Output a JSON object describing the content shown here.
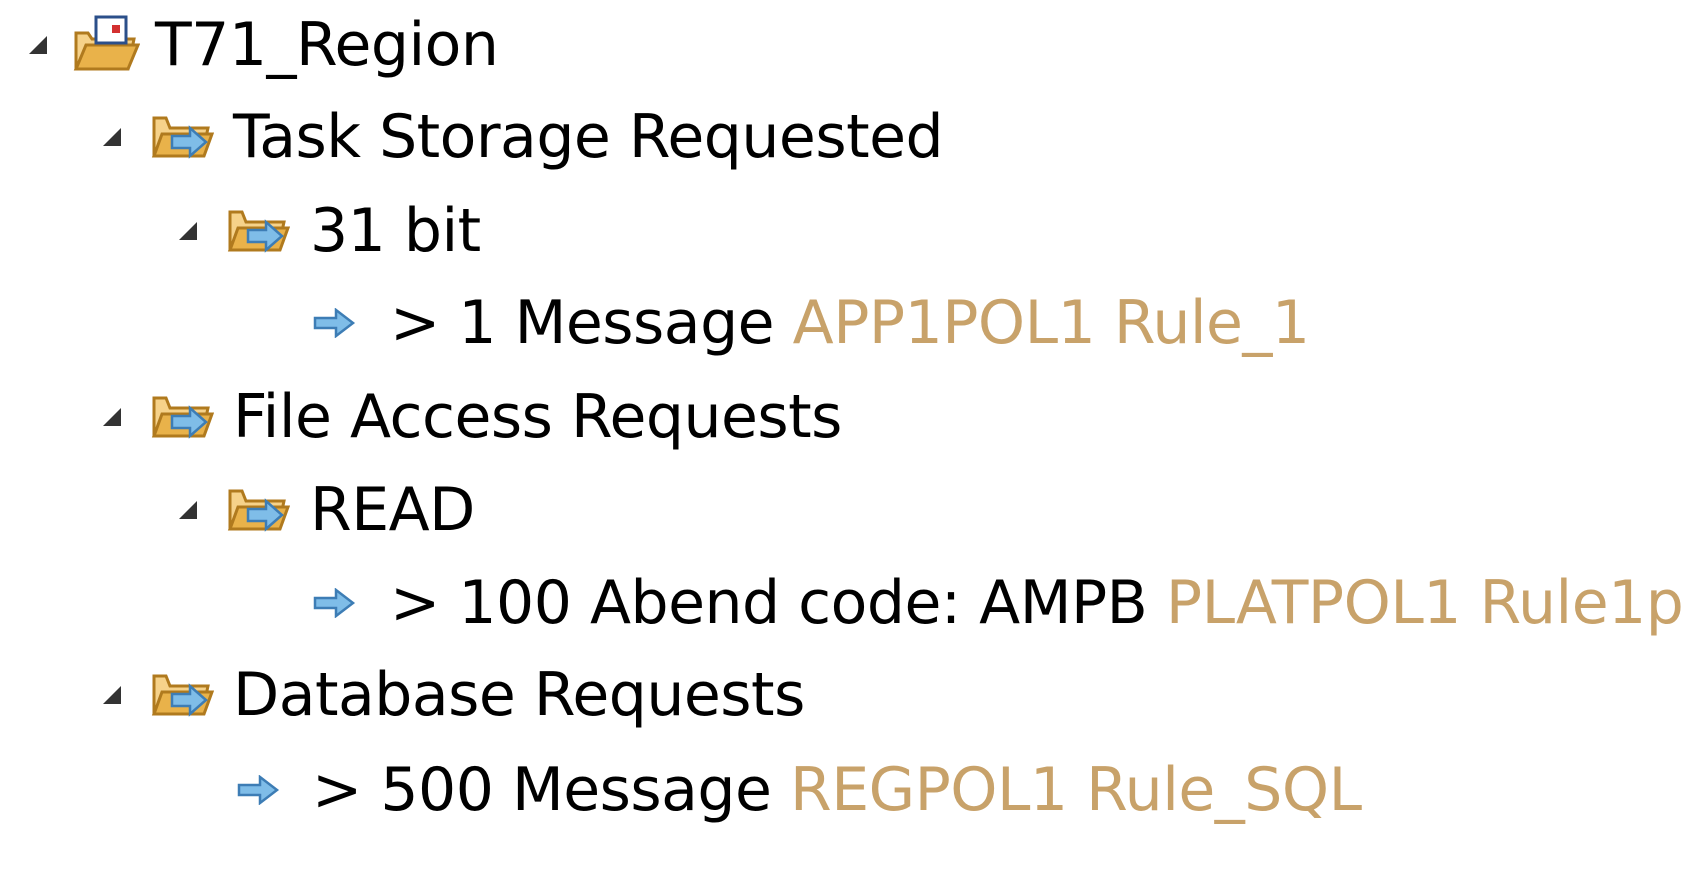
{
  "tree": {
    "root": {
      "label": "T71_Region",
      "icon": "region-folder-icon"
    },
    "groups": [
      {
        "label": "Task Storage Requested",
        "icon": "event-folder-icon",
        "children": [
          {
            "label": "31 bit",
            "icon": "event-folder-icon",
            "children": [
              {
                "prefix": ">",
                "text": "1 Message",
                "policy": "APP1POL1 Rule_1",
                "icon": "rule-arrow-icon"
              }
            ]
          }
        ]
      },
      {
        "label": "File Access Requests",
        "icon": "event-folder-icon",
        "children": [
          {
            "label": "READ",
            "icon": "event-folder-icon",
            "children": [
              {
                "prefix": ">",
                "text": "100 Abend code: AMPB",
                "policy": "PLATPOL1 Rule1p",
                "icon": "rule-arrow-icon"
              }
            ]
          }
        ]
      },
      {
        "label": "Database Requests",
        "icon": "event-folder-icon",
        "children": [
          {
            "prefix": ">",
            "text": "500 Message",
            "policy": "REGPOL1 Rule_SQL",
            "icon": "rule-arrow-icon"
          }
        ]
      }
    ]
  },
  "colors": {
    "text": "#000000",
    "decoration": "#c8a26a",
    "folder": "#e9b24a",
    "arrow": "#5a9fd6",
    "twisty": "#333333"
  }
}
